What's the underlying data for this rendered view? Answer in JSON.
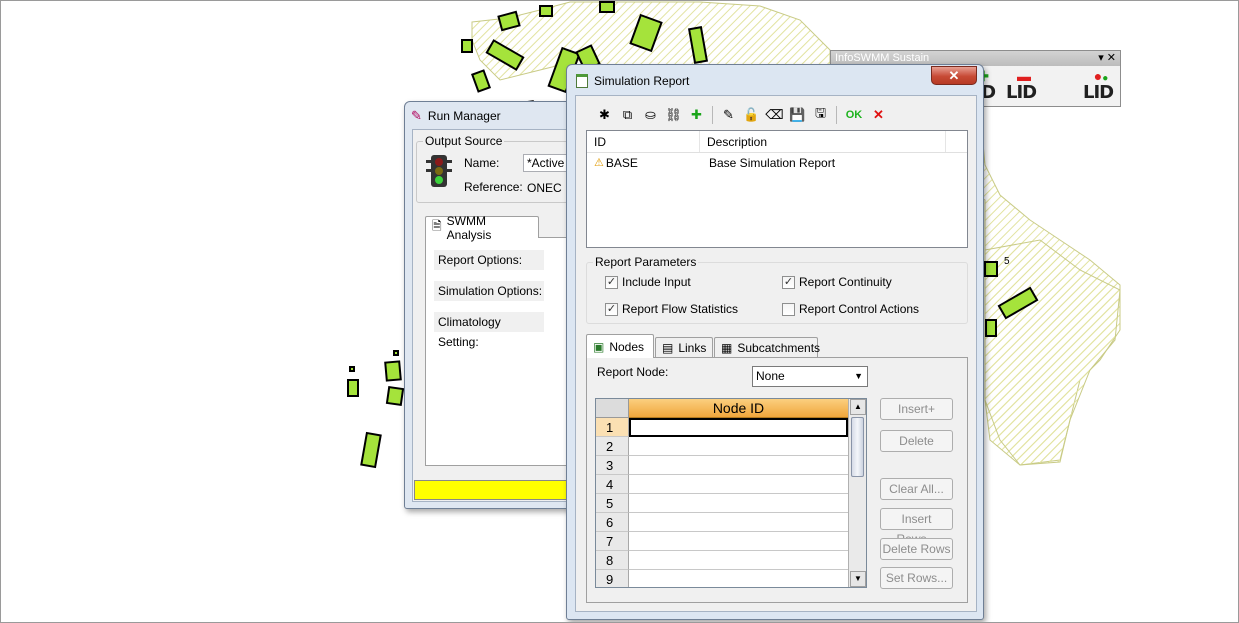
{
  "infoswmm_toolbar": {
    "title": "InfoSWMM Sustain",
    "controls": "▾ ✕",
    "buttons": [
      {
        "label": "LID",
        "symbol": "plus"
      },
      {
        "label": "LID",
        "symbol": "minus"
      },
      {
        "label": "LID",
        "symbol": "cluster"
      }
    ]
  },
  "map": {
    "label": "5"
  },
  "run_manager": {
    "title": "Run Manager",
    "output_source": {
      "label": "Output Source",
      "name_label": "Name:",
      "name_value": "*Active",
      "reference_label": "Reference:",
      "reference_value": "ONEC"
    },
    "tab": "SWMM Analysis",
    "options": [
      "Report Options:",
      "Simulation Options:",
      "Climatology Setting:"
    ],
    "progress": 1.0
  },
  "simulation_report": {
    "title": "Simulation Report",
    "close_label": "✕",
    "toolbar": {
      "ok_label": "OK",
      "cancel_label": "✕"
    },
    "list": {
      "columns": [
        "ID",
        "Description"
      ],
      "rows": [
        {
          "id": "BASE",
          "description": "Base Simulation Report"
        }
      ]
    },
    "report_parameters": {
      "label": "Report Parameters",
      "include_input": {
        "label": "Include Input",
        "checked": true
      },
      "report_continuity": {
        "label": "Report Continuity",
        "checked": true
      },
      "report_flow_statistics": {
        "label": "Report Flow Statistics",
        "checked": true
      },
      "report_control_actions": {
        "label": "Report Control Actions",
        "checked": false
      }
    },
    "tabs": [
      "Nodes",
      "Links",
      "Subcatchments"
    ],
    "nodes": {
      "report_node_label": "Report Node:",
      "report_node_value": "None",
      "grid_header": "Node ID",
      "row_numbers": [
        "1",
        "2",
        "3",
        "4",
        "5",
        "6",
        "7",
        "8",
        "9"
      ]
    },
    "buttons": {
      "insert": "Insert+",
      "delete": "Delete",
      "clear_all": "Clear All...",
      "insert_rows": "Insert Rows...",
      "delete_rows": "Delete Rows",
      "set_rows": "Set Rows..."
    }
  },
  "colors": {
    "polygon_fill": "#a5e33b",
    "hatch": "#e2e3a0",
    "progress": "#ffff00",
    "grid_header": "#f5b24d"
  }
}
